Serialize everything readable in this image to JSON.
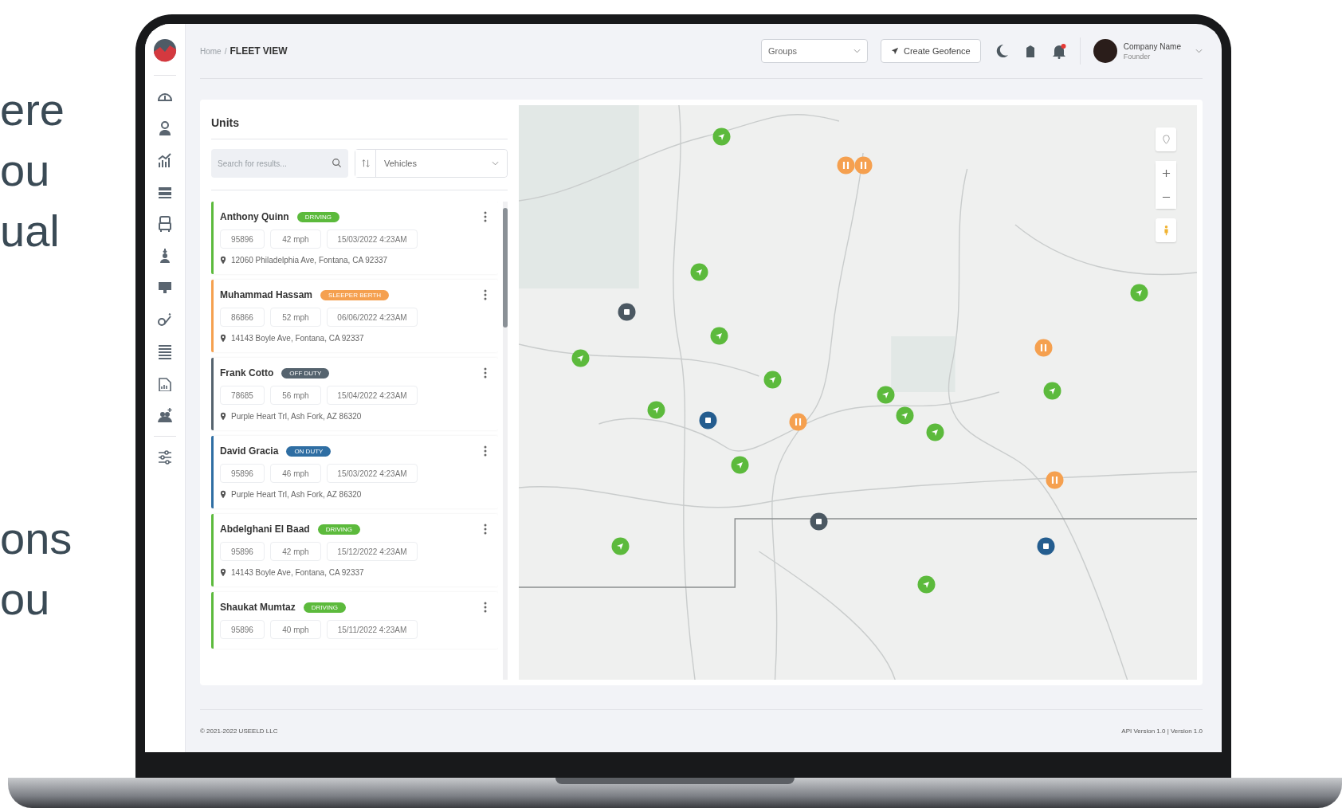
{
  "marketing": [
    "ere",
    "ou",
    "ual",
    "ons",
    "ou"
  ],
  "breadcrumb": {
    "home": "Home",
    "separator": "/",
    "current": "FLEET VIEW"
  },
  "header": {
    "groups_select": {
      "value": "Groups"
    },
    "create_button": "Create Geofence",
    "notifications_unread": true,
    "user": {
      "name": "Company Name",
      "role": "Founder"
    }
  },
  "units_panel": {
    "title": "Units",
    "search": {
      "placeholder": "Search for results..."
    },
    "type_select": {
      "value": "Vehicles"
    }
  },
  "units": [
    {
      "name": "Anthony Quinn",
      "status": "DRIVING",
      "kind": "driving",
      "unit": "95896",
      "speed": "42 mph",
      "time": "15/03/2022 4:23AM",
      "address": "12060 Philadelphia Ave, Fontana, CA 92337"
    },
    {
      "name": "Muhammad Hassam",
      "status": "SLEEPER BERTH",
      "kind": "sleeper",
      "unit": "86866",
      "speed": "52 mph",
      "time": "06/06/2022 4:23AM",
      "address": "14143 Boyle Ave, Fontana, CA 92337"
    },
    {
      "name": "Frank Cotto",
      "status": "OFF DUTY",
      "kind": "off",
      "unit": "78685",
      "speed": "56 mph",
      "time": "15/04/2022 4:23AM",
      "address": "Purple Heart Trl, Ash Fork, AZ 86320"
    },
    {
      "name": "David Gracia",
      "status": "ON DUTY",
      "kind": "on",
      "unit": "95896",
      "speed": "46 mph",
      "time": "15/03/2022 4:23AM",
      "address": "Purple Heart Trl, Ash Fork, AZ 86320"
    },
    {
      "name": "Abdelghani El Baad",
      "status": "DRIVING",
      "kind": "driving",
      "unit": "95896",
      "speed": "42 mph",
      "time": "15/12/2022 4:23AM",
      "address": "14143 Boyle Ave, Fontana, CA 92337"
    },
    {
      "name": "Shaukat Mumtaz",
      "status": "DRIVING",
      "kind": "driving",
      "unit": "95896",
      "speed": "40 mph",
      "time": "15/11/2022 4:23AM"
    }
  ],
  "map": {
    "markers": [
      {
        "kind": "moving"
      },
      {
        "kind": "paused"
      },
      {
        "kind": "paused"
      },
      {
        "kind": "moving"
      },
      {
        "kind": "offline"
      },
      {
        "kind": "moving"
      },
      {
        "kind": "moving"
      },
      {
        "kind": "moving"
      },
      {
        "kind": "moving"
      },
      {
        "kind": "parked"
      },
      {
        "kind": "paused"
      },
      {
        "kind": "moving"
      },
      {
        "kind": "moving"
      },
      {
        "kind": "moving"
      },
      {
        "kind": "moving"
      },
      {
        "kind": "paused"
      },
      {
        "kind": "moving"
      },
      {
        "kind": "moving"
      },
      {
        "kind": "paused"
      },
      {
        "kind": "offline"
      },
      {
        "kind": "parked"
      },
      {
        "kind": "moving"
      },
      {
        "kind": "moving"
      }
    ]
  },
  "footer": {
    "copyright": "© 2021-2022 USEELD LLC",
    "version": "API Version 1.0 | Version 1.0"
  }
}
